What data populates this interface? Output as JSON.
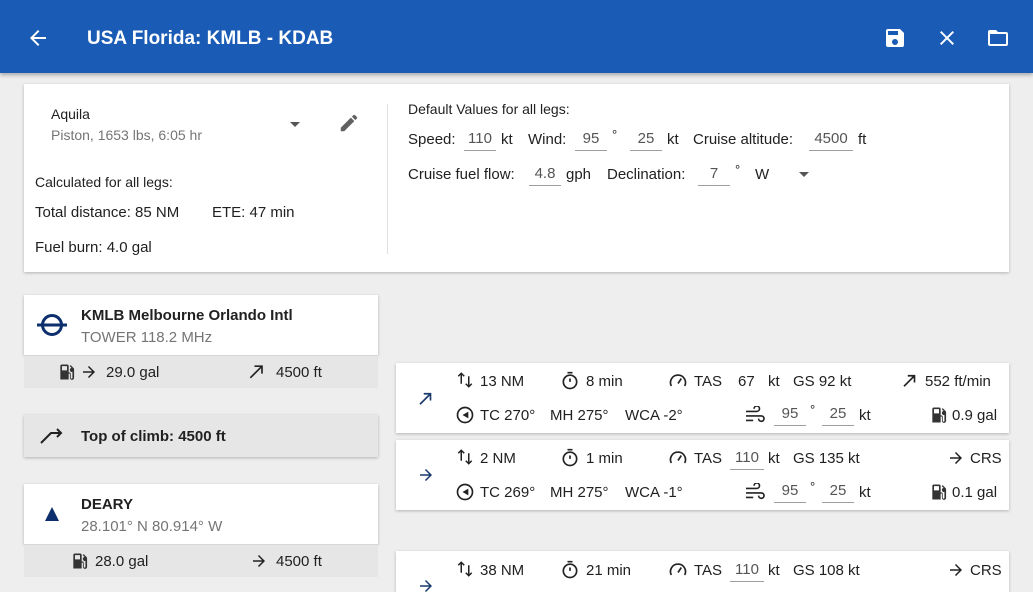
{
  "appbar": {
    "title": "USA Florida: KMLB - KDAB",
    "back_icon": "arrow-left-icon",
    "save_icon": "floppy-disk-icon",
    "close_icon": "close-icon",
    "folder_icon": "folder-icon",
    "color": "#1a5bb5"
  },
  "aircraft": {
    "name": "Aquila",
    "details": "Piston, 1653 lbs, 6:05 hr"
  },
  "calculated": {
    "heading": "Calculated for all legs:",
    "total_distance": "Total distance: 85 NM",
    "ete": "ETE: 47 min",
    "fuel_burn": "Fuel burn: 4.0 gal"
  },
  "defaults": {
    "heading": "Default Values for all legs:",
    "speed_label": "Speed:",
    "speed_value": "110",
    "speed_unit": "kt",
    "wind_label": "Wind:",
    "wind_dir": "95",
    "deg": "°",
    "wind_speed": "25",
    "wind_unit": "kt",
    "alt_label": "Cruise altitude:",
    "alt_value": "4500",
    "alt_unit": "ft",
    "fuel_label": "Cruise fuel flow:",
    "fuel_value": "4.8",
    "fuel_unit": "gph",
    "decl_label": "Declination:",
    "decl_value": "7",
    "decl_dir": "W"
  },
  "waypoints": [
    {
      "title": "KMLB  Melbourne Orlando Intl",
      "subtitle": "TOWER 118.2 MHz",
      "fuel": "29.0 gal",
      "alt": "4500 ft"
    },
    {
      "title": "Top of climb: 4500 ft"
    },
    {
      "title": "DEARY",
      "subtitle": "28.101° N 80.914° W",
      "fuel": "28.0 gal",
      "alt": "4500 ft"
    }
  ],
  "legs": [
    {
      "dist": "13 NM",
      "time": "8 min",
      "tas_label": "TAS",
      "tas": "67",
      "tas_unit": "kt",
      "gs": "GS 92 kt",
      "right_top": "552 ft/min",
      "tc": "TC 270°",
      "mh": "MH 275°",
      "wca": "WCA -2°",
      "wind_dir": "95",
      "deg": "°",
      "wind_speed": "25",
      "wind_unit": "kt",
      "fuel": "0.9 gal"
    },
    {
      "dist": "2 NM",
      "time": "1 min",
      "tas_label": "TAS",
      "tas": "110",
      "tas_unit": "kt",
      "gs": "GS 135 kt",
      "right_top": "CRS",
      "tc": "TC 269°",
      "mh": "MH 275°",
      "wca": "WCA -1°",
      "wind_dir": "95",
      "deg": "°",
      "wind_speed": "25",
      "wind_unit": "kt",
      "fuel": "0.1 gal"
    },
    {
      "dist": "38 NM",
      "time": "21 min",
      "tas_label": "TAS",
      "tas": "110",
      "tas_unit": "kt",
      "gs": "GS 108 kt",
      "right_top": "CRS"
    }
  ]
}
